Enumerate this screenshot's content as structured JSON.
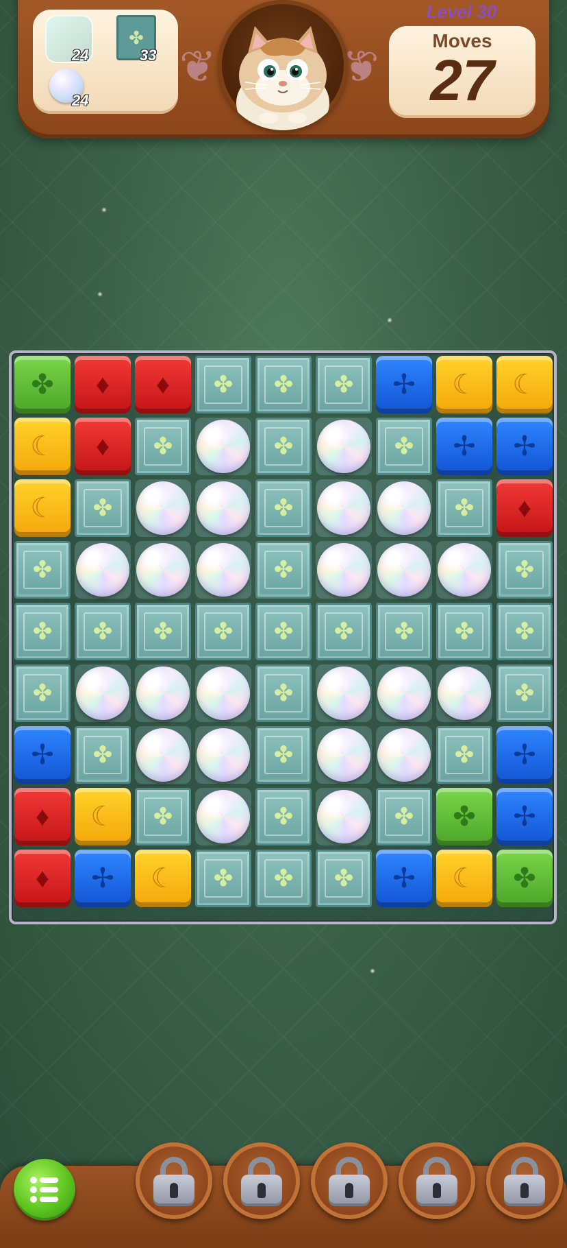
{
  "hud": {
    "level_label": "Level 30",
    "moves_label": "Moves",
    "moves_value": "27",
    "goals": [
      {
        "type": "bubble",
        "count": "24"
      },
      {
        "type": "tile",
        "count": "33"
      },
      {
        "type": "pearl",
        "count": "24"
      }
    ]
  },
  "board": {
    "rows": 9,
    "cols": 9,
    "cells": [
      [
        "G",
        "R",
        "R",
        "T",
        "T",
        "T",
        "B",
        "Y",
        "Y"
      ],
      [
        "Y",
        "R",
        "T",
        "P",
        "T",
        "P",
        "T",
        "B",
        "B"
      ],
      [
        "Y",
        "T",
        "P",
        "P",
        "T",
        "P",
        "P",
        "T",
        "R"
      ],
      [
        "T",
        "P",
        "P",
        "P",
        "T",
        "P",
        "P",
        "P",
        "T"
      ],
      [
        "T",
        "T",
        "T",
        "T",
        "T",
        "T",
        "T",
        "T",
        "T"
      ],
      [
        "T",
        "P",
        "P",
        "P",
        "T",
        "P",
        "P",
        "P",
        "T"
      ],
      [
        "B",
        "T",
        "P",
        "P",
        "T",
        "P",
        "P",
        "T",
        "B"
      ],
      [
        "R",
        "Y",
        "T",
        "P",
        "T",
        "P",
        "T",
        "G",
        "B"
      ],
      [
        "R",
        "B",
        "Y",
        "T",
        "T",
        "T",
        "B",
        "Y",
        "G"
      ]
    ],
    "legend": {
      "G": "green-cube",
      "R": "red-cube",
      "Y": "yellow-cube",
      "B": "blue-cube",
      "T": "ornament-tile",
      "P": "pearl-bubble"
    }
  },
  "icons": {
    "menu": "menu-icon",
    "booster": "lock-icon",
    "mascot": "cat-mascot"
  },
  "boosters": [
    {
      "name": "booster-slot-1",
      "locked": true
    },
    {
      "name": "booster-slot-2",
      "locked": true
    },
    {
      "name": "booster-slot-3",
      "locked": true
    },
    {
      "name": "booster-slot-4",
      "locked": true
    },
    {
      "name": "booster-slot-5",
      "locked": true
    }
  ],
  "colors": {
    "green": "#5bbd2e",
    "red": "#d9201f",
    "yellow": "#fbbd14",
    "blue": "#1f6ef0",
    "tile": "#7db4b1",
    "wood": "#8f4a1c"
  }
}
